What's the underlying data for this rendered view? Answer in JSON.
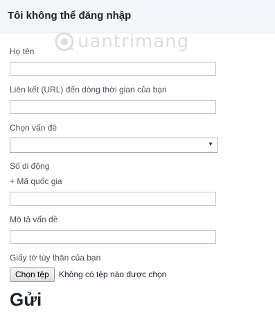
{
  "header": {
    "title": "Tôi không thể đăng nhập"
  },
  "watermark": {
    "text": "uantrimang"
  },
  "form": {
    "name_label": "Họ tên",
    "name_value": "",
    "timeline_label": "Liên kết (URL) đến dòng thời gian của bạn",
    "timeline_value": "",
    "issue_label": "Chọn vấn đề",
    "issue_selected": "",
    "phone_label": "Số di động",
    "country_code_link": "+ Mã quốc gia",
    "phone_value": "",
    "description_label": "Mô tả vấn đề",
    "description_value": "",
    "id_label": "Giấy tờ tùy thân của bạn",
    "file_button": "Chọn tệp",
    "file_status": "Không có tệp nào được chọn",
    "submit_label": "Gửi"
  },
  "icons": {
    "select_arrow": "chevron-down-icon",
    "watermark_logo": "quantrimang-logo-icon"
  }
}
